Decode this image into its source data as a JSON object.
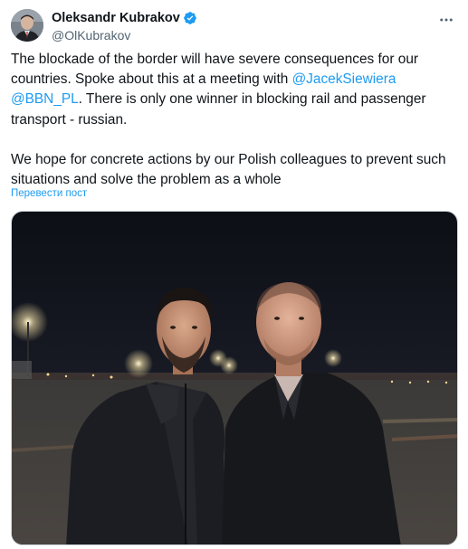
{
  "author": {
    "display_name": "Oleksandr Kubrakov",
    "handle": "@OlKubrakov",
    "verified": true,
    "avatar_icon": "avatar-photo"
  },
  "menu": {
    "more_icon": "more-horizontal-icon"
  },
  "tweet": {
    "p1_part1": "The blockade of the border will have severe consequences for our countries. Spoke about this at a meeting with ",
    "mention1": "@JacekSiewiera",
    "p1_space": " ",
    "mention2": "@BBN_PL",
    "p1_part2": ". There is only one winner in blocking rail and passenger transport - russian.",
    "p2": "We hope for concrete actions by our Polish colleagues to prevent such situations and solve the problem as a whole"
  },
  "translate_link": "Перевести пост",
  "media": {
    "type": "photo",
    "description_icon": "photo-two-men-airport-night"
  },
  "colors": {
    "text": "#0f1419",
    "secondary": "#536471",
    "link": "#1d9bf0",
    "verified": "#1d9bf0",
    "border": "#cfd9de"
  }
}
